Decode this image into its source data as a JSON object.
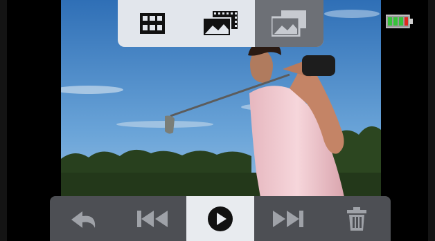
{
  "top_menu": {
    "items": [
      {
        "icon": "grid-view-icon",
        "state": "inactive"
      },
      {
        "icon": "video-gallery-icon",
        "state": "inactive"
      },
      {
        "icon": "photo-gallery-icon",
        "state": "active"
      }
    ]
  },
  "battery": {
    "icon": "battery-icon",
    "level_segments_filled": 3,
    "low_segment_color": "#e0281e",
    "charge_color": "#36c23a"
  },
  "playback": {
    "items": [
      {
        "icon": "back-icon",
        "state": "inactive"
      },
      {
        "icon": "previous-track-icon",
        "state": "inactive"
      },
      {
        "icon": "play-icon",
        "state": "active"
      },
      {
        "icon": "next-track-icon",
        "state": "inactive"
      },
      {
        "icon": "trash-icon",
        "state": "inactive"
      }
    ]
  },
  "colors": {
    "toolbar_light": "#e2e6ec",
    "toolbar_active": "#6d7076",
    "controls_dark": "#4d4f54"
  }
}
